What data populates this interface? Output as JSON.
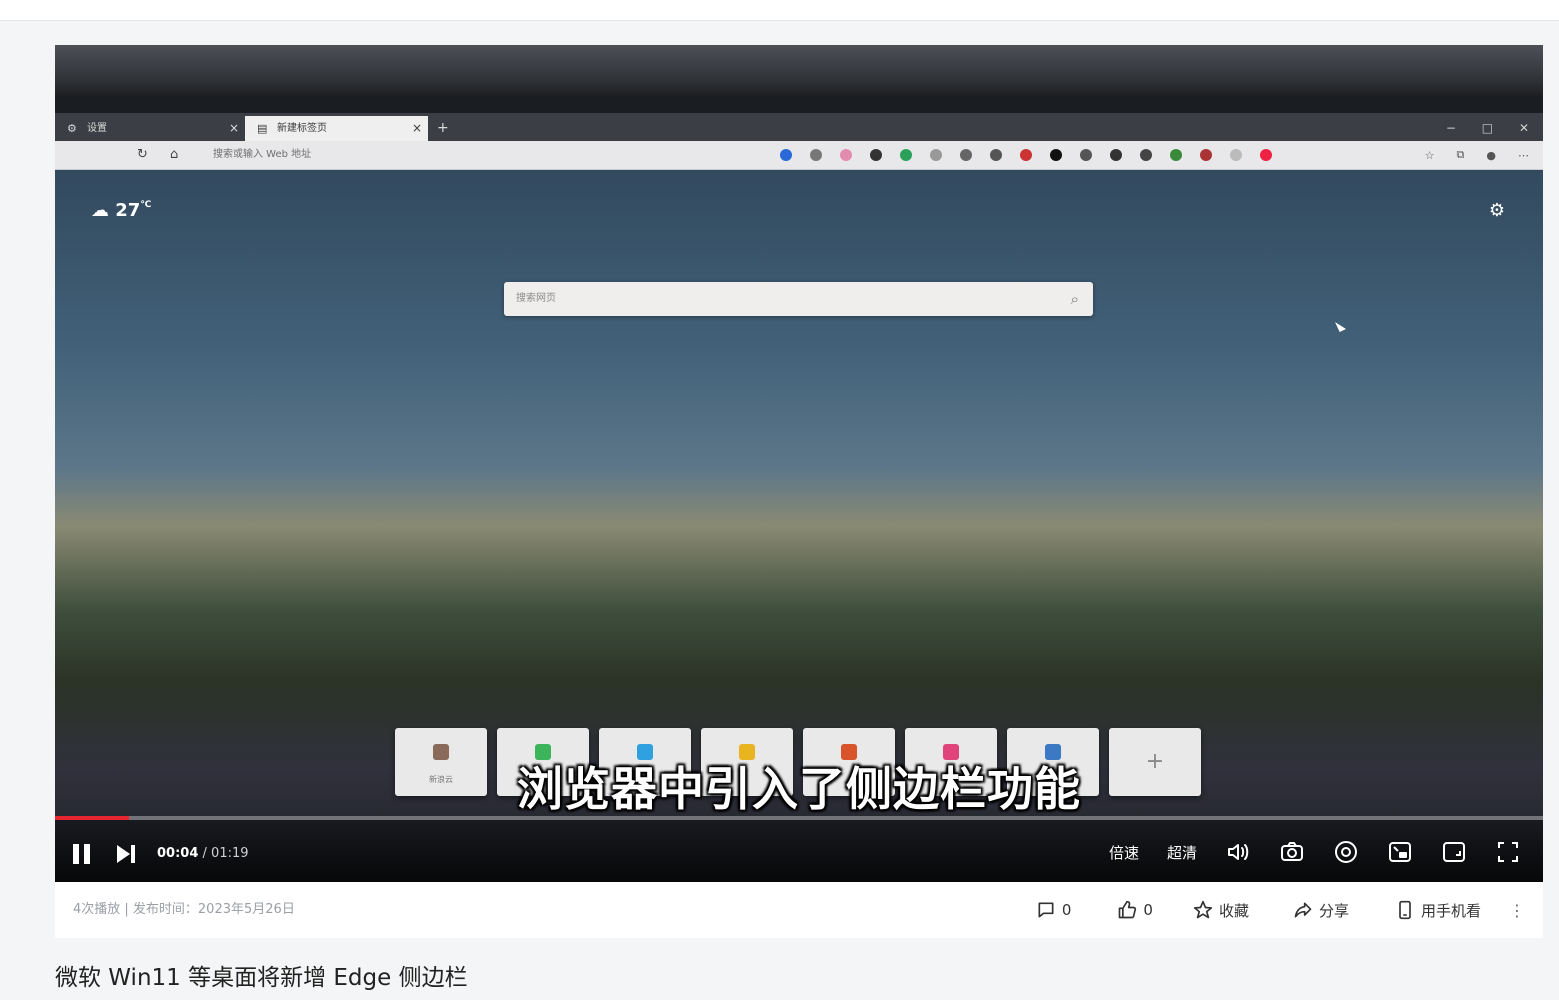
{
  "video": {
    "subtitle": "浏览器中引入了侧边栏功能",
    "current_time": "00:04",
    "separator": " / ",
    "duration": "01:19",
    "progress": 0.05,
    "controls": {
      "speed_label": "倍速",
      "quality_label": "超清"
    }
  },
  "embedded_browser": {
    "tabs": [
      {
        "label": "设置"
      },
      {
        "label": "新建标签页"
      }
    ],
    "address_placeholder": "搜索或输入 Web 地址",
    "weather": "27",
    "weather_unit": "℃",
    "search_placeholder": "搜索网页",
    "tiles": [
      {
        "label": "新浪云",
        "color": "#8a6b5a"
      },
      {
        "label": "",
        "color": "#3cb55a"
      },
      {
        "label": "",
        "color": "#2fa0e0"
      },
      {
        "label": "",
        "color": "#e8b520"
      },
      {
        "label": "",
        "color": "#d9532b"
      },
      {
        "label": "",
        "color": "#e0447a"
      },
      {
        "label": "",
        "color": "#3b79c4"
      }
    ]
  },
  "meta": {
    "text": "4次播放 | 发布时间：2023年5月26日"
  },
  "actions": {
    "comments": "0",
    "likes": "0",
    "favorite_label": "收藏",
    "share_label": "分享",
    "mobile_label": "用手机看"
  },
  "page": {
    "title": "微软 Win11 等桌面将新增 Edge 侧边栏"
  },
  "colors": {
    "progress_red": "#e6252f",
    "background": "#f4f5f6"
  }
}
